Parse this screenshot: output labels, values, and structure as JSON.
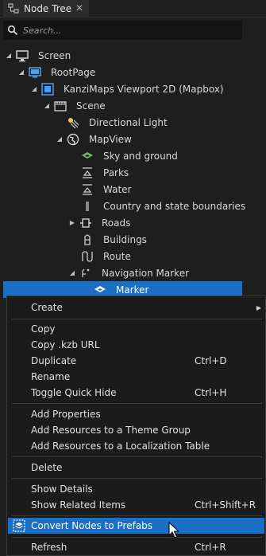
{
  "tab": {
    "label": "Node Tree",
    "close": "✕"
  },
  "search": {
    "placeholder": "Search..."
  },
  "tree": {
    "screen": "Screen",
    "rootpage": "RootPage",
    "viewport": "KanziMaps Viewport 2D (Mapbox)",
    "scene": "Scene",
    "directional_light": "Directional Light",
    "mapview": "MapView",
    "sky": "Sky and ground",
    "parks": "Parks",
    "water": "Water",
    "boundaries": "Country and state boundaries",
    "roads": "Roads",
    "buildings": "Buildings",
    "route": "Route",
    "nav_marker": "Navigation Marker",
    "marker": "Marker"
  },
  "menu": {
    "create": "Create",
    "copy": "Copy",
    "copy_url": "Copy .kzb URL",
    "duplicate": "Duplicate",
    "duplicate_shortcut": "Ctrl+D",
    "rename": "Rename",
    "toggle_quick_hide": "Toggle Quick Hide",
    "toggle_quick_hide_shortcut": "Ctrl+H",
    "add_properties": "Add Properties",
    "add_theme": "Add Resources to a Theme Group",
    "add_localization": "Add Resources to a Localization Table",
    "delete": "Delete",
    "show_details": "Show Details",
    "show_related": "Show Related Items",
    "show_related_shortcut": "Ctrl+Shift+R",
    "convert_prefabs": "Convert Nodes to Prefabs",
    "refresh": "Refresh",
    "refresh_shortcut": "Ctrl+R"
  },
  "colors": {
    "selection": "#1a6fc7",
    "background": "#1e1e1e",
    "menu_bg": "#1b1b1b"
  }
}
